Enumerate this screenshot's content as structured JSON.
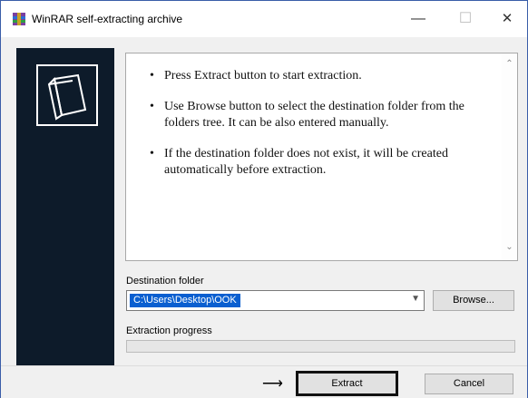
{
  "window": {
    "title": "WinRAR self-extracting archive"
  },
  "colors": {
    "sidebar": "#0d1b2a",
    "selection": "#0a5fd0",
    "titlebar": "#ffffff"
  },
  "icons": {
    "app": "winrar-icon",
    "logo": "archive-logo-icon",
    "minimize": "minimize-icon",
    "maximize": "maximize-icon",
    "close": "close-icon"
  },
  "instructions": [
    "Press Extract button to start extraction.",
    "Use Browse button to select the destination folder from the folders tree. It can be also entered manually.",
    "If the destination folder does not exist, it will be created automatically before extraction."
  ],
  "destination": {
    "label": "Destination folder",
    "value": "C:\\Users\\Desktop\\OOK"
  },
  "progress": {
    "label": "Extraction progress",
    "value": 0
  },
  "buttons": {
    "browse": "Browse...",
    "extract": "Extract",
    "cancel": "Cancel"
  }
}
